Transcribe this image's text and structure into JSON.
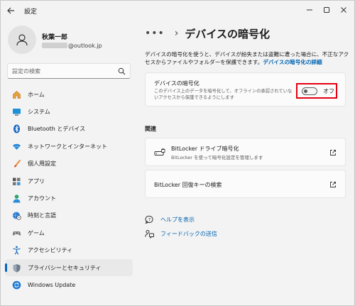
{
  "window": {
    "title": "設定"
  },
  "account": {
    "name": "秋葉一郎",
    "email": "@outlook.jp"
  },
  "search": {
    "placeholder": "設定の検索"
  },
  "sidebar": {
    "items": [
      {
        "label": "ホーム",
        "icon": "home-icon"
      },
      {
        "label": "システム",
        "icon": "system-icon"
      },
      {
        "label": "Bluetooth とデバイス",
        "icon": "bluetooth-icon"
      },
      {
        "label": "ネットワークとインターネット",
        "icon": "wifi-icon"
      },
      {
        "label": "個人用設定",
        "icon": "brush-icon"
      },
      {
        "label": "アプリ",
        "icon": "apps-icon"
      },
      {
        "label": "アカウント",
        "icon": "account-icon"
      },
      {
        "label": "時刻と言語",
        "icon": "globe-clock-icon"
      },
      {
        "label": "ゲーム",
        "icon": "gamepad-icon"
      },
      {
        "label": "アクセシビリティ",
        "icon": "accessibility-icon"
      },
      {
        "label": "プライバシーとセキュリティ",
        "icon": "shield-icon",
        "selected": true
      },
      {
        "label": "Windows Update",
        "icon": "update-icon"
      }
    ]
  },
  "breadcrumb": {
    "more": "•••",
    "title": "デバイスの暗号化"
  },
  "description": {
    "text": "デバイスの暗号化を使うと、デバイスが紛失または盗難に遭った場合に、不正なアクセスからファイルやフォルダーを保護できます。",
    "link": "デバイスの暗号化の詳細"
  },
  "encryption_card": {
    "title": "デバイスの暗号化",
    "subtitle": "このデバイス上のデータを暗号化して、オフラインの承認されていないアクセスから保護できるようにします",
    "toggle_state": "オフ",
    "toggle_on": false,
    "highlight_color": "#e60012"
  },
  "related": {
    "heading": "関連",
    "bitlocker": {
      "title": "BitLocker ドライブ暗号化",
      "subtitle": "BitLocker を使って暗号化設定を管理します"
    },
    "recovery": {
      "title": "BitLocker 回復キーの検索"
    }
  },
  "links": {
    "help": "ヘルプを表示",
    "feedback": "フィードバックの送信"
  },
  "colors": {
    "accent": "#0067c0",
    "link": "#0063b1",
    "background": "#f3f3f3",
    "card": "#fbfbfb"
  }
}
